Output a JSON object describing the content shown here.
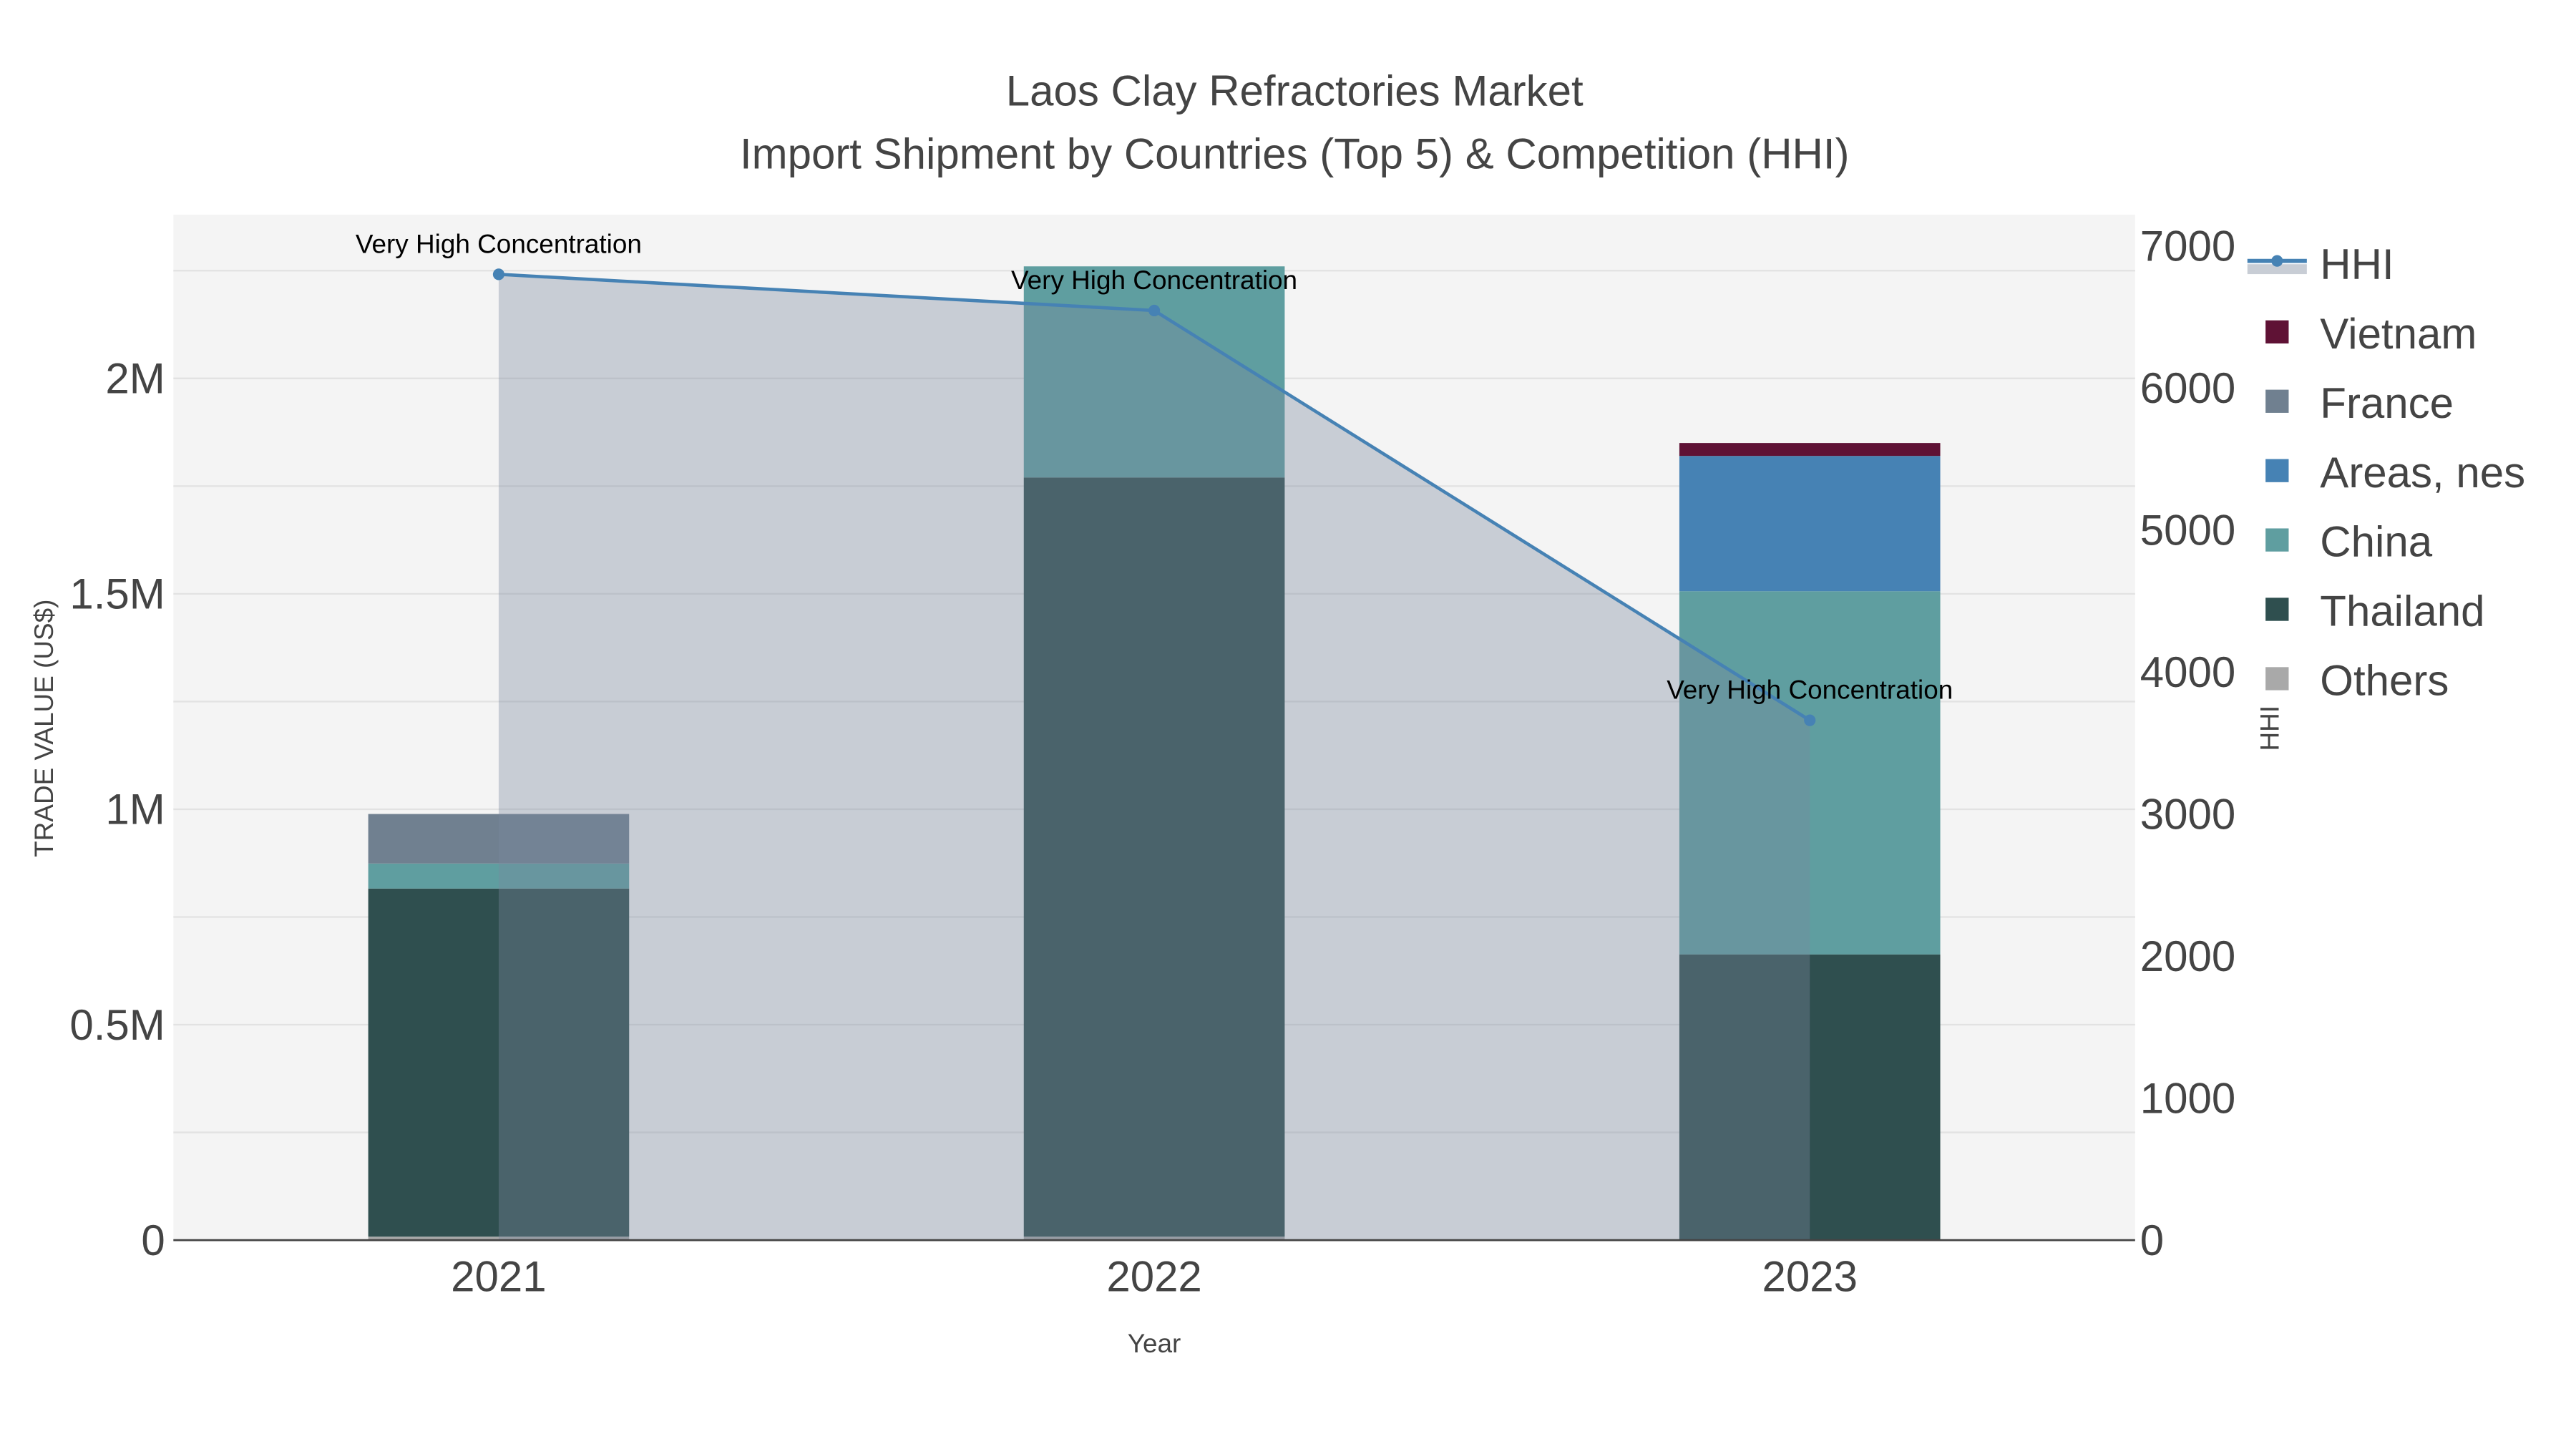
{
  "chart_data": {
    "type": "bar",
    "title": "Laos Clay Refractories Market",
    "subtitle": "Import Shipment by Countries (Top 5) & Competition (HHI)",
    "xlabel": "Year",
    "ylabel": "TRADE VALUE (US$)",
    "y2label": "HHI",
    "categories": [
      "2021",
      "2022",
      "2023"
    ],
    "ylim": [
      0,
      2380000
    ],
    "y2lim": [
      0,
      7220
    ],
    "yticks": [
      {
        "v": 0,
        "label": "0"
      },
      {
        "v": 500000,
        "label": "0.5M"
      },
      {
        "v": 1000000,
        "label": "1M"
      },
      {
        "v": 1500000,
        "label": "1.5M"
      },
      {
        "v": 2000000,
        "label": "2M"
      }
    ],
    "y2ticks": [
      {
        "v": 0,
        "label": "0"
      },
      {
        "v": 1000,
        "label": "1000"
      },
      {
        "v": 2000,
        "label": "2000"
      },
      {
        "v": 3000,
        "label": "3000"
      },
      {
        "v": 4000,
        "label": "4000"
      },
      {
        "v": 5000,
        "label": "5000"
      },
      {
        "v": 6000,
        "label": "6000"
      },
      {
        "v": 7000,
        "label": "7000"
      }
    ],
    "series": [
      {
        "name": "Others",
        "color": "#a9a9a9",
        "values": [
          8000,
          8000,
          0
        ]
      },
      {
        "name": "Thailand",
        "color": "#2f4f4f",
        "values": [
          808000,
          1762000,
          663000
        ]
      },
      {
        "name": "China",
        "color": "#5f9ea0",
        "values": [
          58000,
          490000,
          843000
        ]
      },
      {
        "name": "Areas, nes",
        "color": "#4682b4",
        "values": [
          0,
          0,
          314000
        ]
      },
      {
        "name": "France",
        "color": "#708090",
        "values": [
          115000,
          0,
          0
        ]
      },
      {
        "name": "Vietnam",
        "color": "#5f1235",
        "values": [
          0,
          0,
          30000
        ]
      }
    ],
    "hhi": {
      "name": "HHI",
      "color": "#4682b4",
      "values": [
        6800,
        6545,
        3660
      ],
      "annotations": [
        "Very High Concentration",
        "Very High Concentration",
        "Very High Concentration"
      ]
    },
    "legend": [
      "HHI",
      "Vietnam",
      "France",
      "Areas, nes",
      "China",
      "Thailand",
      "Others"
    ],
    "legend_position": "right",
    "grid": true
  }
}
